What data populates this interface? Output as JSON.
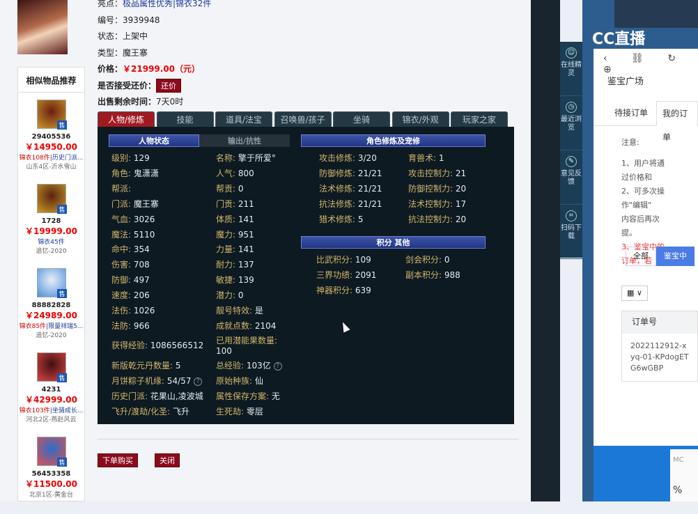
{
  "item": {
    "highlight_label": "亮点：",
    "highlight_value": "极品属性优秀|锦衣32件",
    "id_label": "编号：",
    "id_value": "3939948",
    "status_label": "状态：",
    "status_value": "上架中",
    "type_label": "类型：",
    "type_value": "魔王寨",
    "price_label": "价格：",
    "price_value": "￥21999.00（元）",
    "bargain_label": "是否接受还价：",
    "bargain_button": "还价",
    "remaining_label": "出售剩余时间：",
    "remaining_value": "7天0时"
  },
  "recommend": {
    "title": "相似物品推荐",
    "sale_badge": "售",
    "items": [
      {
        "id": "29405536",
        "price": "￥14950.00",
        "tag1": "锦衣108件",
        "tag2": "|历史门派...",
        "server": "山东4区-沂水雪山"
      },
      {
        "id": "1728",
        "price": "￥19999.00",
        "tag1": "",
        "tag2": "锦衣45件",
        "server": "追忆-2020"
      },
      {
        "id": "88882828",
        "price": "￥24989.00",
        "tag1": "锦衣85件",
        "tag2": "|限量祥瑞5...",
        "server": "追忆-2020"
      },
      {
        "id": "4231",
        "price": "￥42999.00",
        "tag1": "锦衣103件",
        "tag2": "|坐骑成长...",
        "server": "河北2区-燕赵风云"
      },
      {
        "id": "56453358",
        "price": "￥11500.00",
        "tag1": "",
        "tag2": "",
        "server": "北京1区-黄金台"
      }
    ]
  },
  "tabs": [
    "人物/修炼",
    "技能",
    "道具/法宝",
    "召唤兽/孩子",
    "坐骑",
    "锦衣/外观",
    "玩家之家"
  ],
  "panel": {
    "sec_status": "人物状态",
    "sec_output": "输出/抗性",
    "sec_cultivation": "角色修炼及宠修",
    "sec_points": "积分 其他",
    "col1": [
      {
        "k": "级别:",
        "v": "129"
      },
      {
        "k": "角色:",
        "v": "鬼潇潇"
      },
      {
        "k": "帮派:",
        "v": ""
      },
      {
        "k": "门派:",
        "v": "魔王寨"
      },
      {
        "k": "气血:",
        "v": "3026"
      },
      {
        "k": "魔法:",
        "v": "5110"
      },
      {
        "k": "命中:",
        "v": "354"
      },
      {
        "k": "伤害:",
        "v": "708"
      },
      {
        "k": "防御:",
        "v": "497"
      },
      {
        "k": "速度:",
        "v": "206"
      },
      {
        "k": "法伤:",
        "v": "1026"
      },
      {
        "k": "法防:",
        "v": "966"
      }
    ],
    "col2": [
      {
        "k": "名称:",
        "v": "擎于所爱°"
      },
      {
        "k": "人气:",
        "v": "800"
      },
      {
        "k": "帮贡:",
        "v": "0"
      },
      {
        "k": "门贡:",
        "v": "211"
      },
      {
        "k": "体质:",
        "v": "141"
      },
      {
        "k": "魔力:",
        "v": "951"
      },
      {
        "k": "力量:",
        "v": "141"
      },
      {
        "k": "耐力:",
        "v": "137"
      },
      {
        "k": "敏捷:",
        "v": "139"
      },
      {
        "k": "潜力:",
        "v": "0"
      },
      {
        "k": "靓号特效:",
        "v": "是"
      },
      {
        "k": "成就点数:",
        "v": "2104"
      }
    ],
    "exp_label": "获得经验:",
    "exp_value": "1086566512",
    "potential_label": "已用潜能果数量:",
    "potential_value": "100",
    "qian_label": "新版乾元丹数量:",
    "qian_value": "5",
    "total_label": "总经验:",
    "total_value": "103亿",
    "moon_label": "月饼粽子机缘:",
    "moon_value": "54/57",
    "race_label": "原始种族:",
    "race_value": "仙",
    "history_label": "历史门派:",
    "history_value": "花果山,凌波城",
    "save_label": "属性保存方案:",
    "save_value": "无",
    "fly_label": "飞升/渡劫/化圣:",
    "fly_value": "飞升",
    "life_label": "生死劫:",
    "life_value": "零层",
    "cult_left": [
      {
        "k": "攻击修炼:",
        "v": "3/20"
      },
      {
        "k": "防御修炼:",
        "v": "21/21"
      },
      {
        "k": "法术修炼:",
        "v": "21/21"
      },
      {
        "k": "抗法修炼:",
        "v": "21/21"
      },
      {
        "k": "猎术修炼:",
        "v": "5"
      }
    ],
    "cult_right": [
      {
        "k": "育兽术:",
        "v": "1"
      },
      {
        "k": "攻击控制力:",
        "v": "21"
      },
      {
        "k": "防御控制力:",
        "v": "20"
      },
      {
        "k": "法术控制力:",
        "v": "17"
      },
      {
        "k": "抗法控制力:",
        "v": "20"
      }
    ],
    "points": [
      {
        "k": "比武积分:",
        "v": "109"
      },
      {
        "k": "剑会积分:",
        "v": "0"
      },
      {
        "k": "三界功绩:",
        "v": "2091"
      },
      {
        "k": "副本积分:",
        "v": "988"
      },
      {
        "k": "神器积分:",
        "v": "639"
      }
    ],
    "help_glyph": "?"
  },
  "actions": {
    "buy": "下单购买",
    "close": "关闭"
  },
  "sidebar": [
    {
      "icon": "☺",
      "label": "在线精灵"
    },
    {
      "icon": "◷",
      "label": "最近浏览"
    },
    {
      "icon": "✎",
      "label": "意见反馈"
    },
    {
      "icon": "⌗",
      "label": "扫码下载"
    }
  ],
  "cc": {
    "logo": "CC直播"
  },
  "right": {
    "nav": "‹ ⛓ ↻ ⊕",
    "title": "鉴宝广场",
    "tab_pending": "待接订单",
    "tab_mine": "我的订单",
    "note_title": "注意:",
    "note1": "1、用户将通过价格和",
    "note2": "2、可多次操作\"编辑\"",
    "note2b": "内容后再次提。",
    "note3": "3、鉴宝中的订单，若",
    "filter_all": "全部",
    "filter_active": "鉴宝中",
    "grid_label": "▦ ∨",
    "col_order": "订单号",
    "order_no": "2022112912-xyq-01-KPdogETG6wGBP",
    "bottom1": "MC",
    "bottom2": "%"
  }
}
